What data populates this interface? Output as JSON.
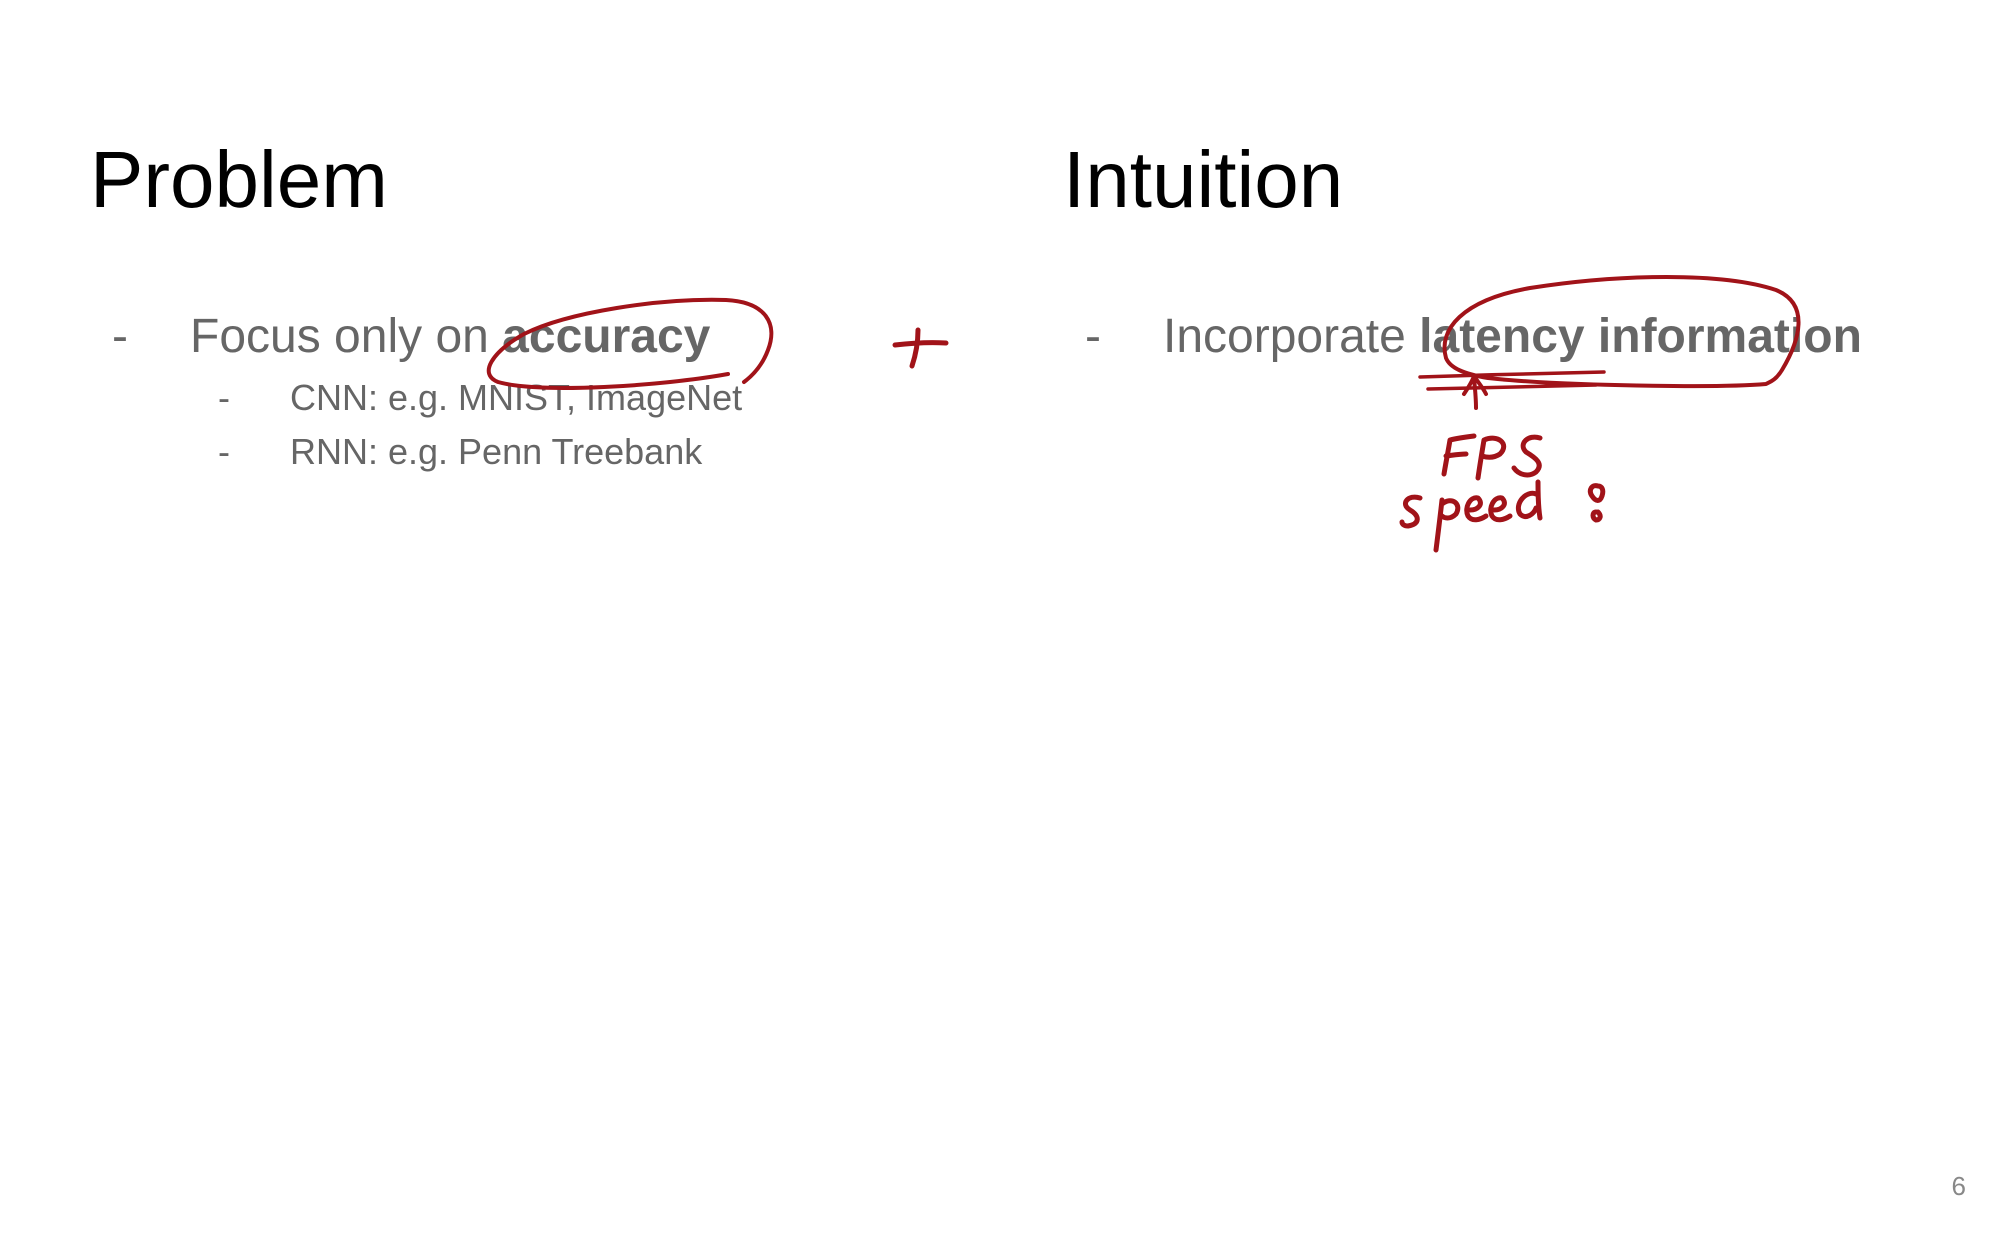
{
  "slide": {
    "page_number": "6",
    "columns": [
      {
        "title": "Problem",
        "bullets": [
          {
            "marker": "-",
            "text_plain": "Focus only on ",
            "text_bold": "accuracy",
            "sub_bullets": [
              {
                "marker": "-",
                "text": "CNN: e.g. MNIST, ImageNet"
              },
              {
                "marker": "-",
                "text": "RNN: e.g. Penn Treebank"
              }
            ]
          }
        ]
      },
      {
        "title": "Intuition",
        "bullets": [
          {
            "marker": "-",
            "text_plain": "Incorporate ",
            "text_bold": "latency information",
            "sub_bullets": []
          }
        ]
      }
    ]
  },
  "annotations": {
    "ink_color": "#a11319",
    "handwritten": [
      "+",
      "FPS",
      "speed !"
    ],
    "marks": [
      "circle-accuracy",
      "circle-latency-information",
      "underline-latency",
      "arrow-up"
    ]
  },
  "colors": {
    "title": "#000000",
    "body_text": "#666666",
    "page_number": "#888888",
    "background": "#ffffff"
  }
}
